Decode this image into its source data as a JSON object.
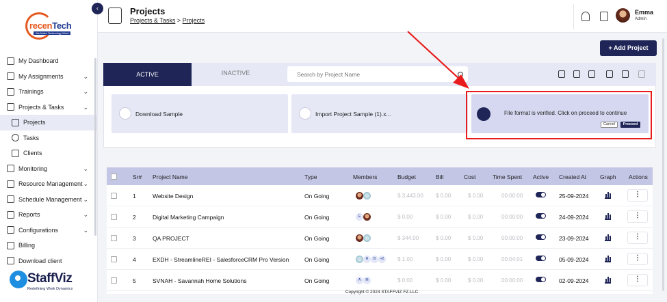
{
  "app": {
    "logo_text_left": "recen",
    "logo_text_right": "Tech",
    "logo_tagline": "We Make Technology Work",
    "brand_name": "StaffViz",
    "brand_tagline": "Redefining Work Dynamics"
  },
  "sidebar": {
    "items": [
      {
        "label": "My Dashboard",
        "icon": "dashboard-icon",
        "expandable": false
      },
      {
        "label": "My Assignments",
        "icon": "assignments-icon",
        "expandable": true
      },
      {
        "label": "Trainings",
        "icon": "play-icon",
        "expandable": true
      },
      {
        "label": "Projects & Tasks",
        "icon": "briefcase-icon",
        "expandable": true
      },
      {
        "label": "Projects",
        "icon": "projects-icon",
        "sub": true,
        "active": true
      },
      {
        "label": "Tasks",
        "icon": "check-circle-icon",
        "sub": true
      },
      {
        "label": "Clients",
        "icon": "clients-icon",
        "sub": true
      },
      {
        "label": "Monitoring",
        "icon": "monitor-icon",
        "expandable": true
      },
      {
        "label": "Resource Management",
        "icon": "resource-icon",
        "expandable": true
      },
      {
        "label": "Schedule Management",
        "icon": "calendar-icon",
        "expandable": true
      },
      {
        "label": "Reports",
        "icon": "report-icon",
        "expandable": true
      },
      {
        "label": "Configurations",
        "icon": "gear-icon",
        "expandable": true
      },
      {
        "label": "Billing",
        "icon": "billing-icon",
        "expandable": false
      },
      {
        "label": "Download client",
        "icon": "download-icon",
        "expandable": false
      }
    ]
  },
  "header": {
    "title": "Projects",
    "breadcrumb_parent": "Projects & Tasks",
    "breadcrumb_separator": ">",
    "breadcrumb_current": "Projects",
    "user_name": "Emma",
    "user_role": "Admin"
  },
  "toolbar": {
    "add_label": "+ Add Project",
    "tab_active": "ACTIVE",
    "tab_inactive": "INACTIVE",
    "search_placeholder": "Search by Project Name"
  },
  "import": {
    "download_label": "Download Sample",
    "file_label": "Import Project Sample (1).x...",
    "verified_message": "File format is verified. Click on proceed to continue",
    "cancel_label": "Cancel",
    "proceed_label": "Proceed"
  },
  "table": {
    "columns": [
      "Sr#",
      "Project Name",
      "Type",
      "Members",
      "Budget",
      "Bill",
      "Cost",
      "Time Spent",
      "Active",
      "Created At",
      "Graph",
      "Actions"
    ],
    "rows": [
      {
        "sr": "1",
        "name": "Website Design",
        "type": "On Going",
        "budget": "$ 3,443.00",
        "bill": "$ 0.00",
        "cost": "$ 0.00",
        "time": "00:00:00",
        "created": "25-09-2024",
        "active": true,
        "members": [
          "photo",
          "grad"
        ]
      },
      {
        "sr": "2",
        "name": "Digital Marketing Campaign",
        "type": "On Going",
        "budget": "$ 0.00",
        "bill": "$ 0.00",
        "cost": "$ 0.00",
        "time": "00:00:00",
        "created": "24-09-2024",
        "active": true,
        "members": [
          "E",
          "photo"
        ]
      },
      {
        "sr": "3",
        "name": "QA PROJECT",
        "type": "On Going",
        "budget": "$ 344.00",
        "bill": "$ 0.00",
        "cost": "$ 0.00",
        "time": "00:00:00",
        "created": "23-09-2024",
        "active": true,
        "members": [
          "photo",
          "grad"
        ]
      },
      {
        "sr": "4",
        "name": "EXDH - StreamlineREI - SalesforceCRM Pro Version",
        "type": "On Going",
        "budget": "$ 1.00",
        "bill": "$ 0.00",
        "cost": "$ 0.00",
        "time": "00:04:01",
        "created": "05-09-2024",
        "active": true,
        "members": [
          "grad",
          "R",
          "B",
          "+2"
        ]
      },
      {
        "sr": "5",
        "name": "SVNAH - Savannah Home Solutions",
        "type": "On Going",
        "budget": "$ 0.00",
        "bill": "$ 0.00",
        "cost": "$ 0.00",
        "time": "00:00:00",
        "created": "02-09-2024",
        "active": true,
        "members": [
          "A",
          "M"
        ]
      }
    ]
  },
  "footer": {
    "copyright": "Copyright © 2024 STAFFVIZ FZ-LLC."
  },
  "colors": {
    "brand_navy": "#1f2557",
    "highlight_red": "#e81c1c",
    "table_header": "#c4c6e6"
  }
}
